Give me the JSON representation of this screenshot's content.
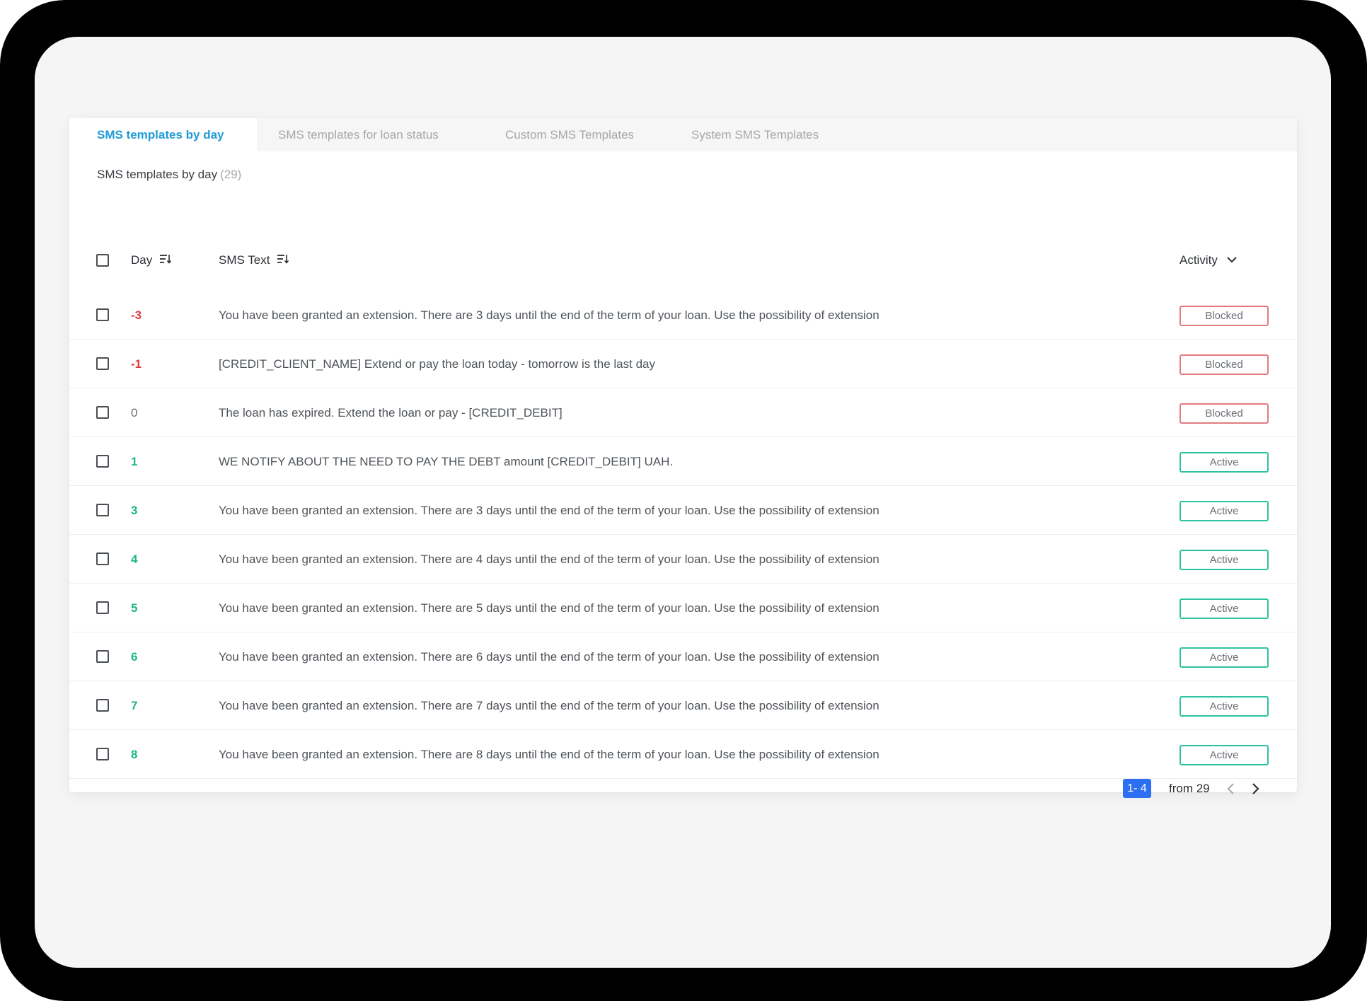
{
  "tabs": [
    {
      "label": "SMS templates by day",
      "active": true
    },
    {
      "label": "SMS templates for loan status",
      "active": false
    },
    {
      "label": "Custom SMS Templates",
      "active": false
    },
    {
      "label": "System SMS Templates",
      "active": false
    }
  ],
  "section": {
    "title": "SMS templates by day",
    "count": "(29)"
  },
  "table": {
    "columns": {
      "day": "Day",
      "sms_text": "SMS Text",
      "activity": "Activity"
    },
    "rows": [
      {
        "day": "-3",
        "text": "You have been granted an extension. There are 3 days until the end of the term of your loan. Use the possibility of extension",
        "status": "Blocked"
      },
      {
        "day": "-1",
        "text": "[CREDIT_CLIENT_NAME] Extend or pay the loan today - tomorrow is the last day",
        "status": "Blocked"
      },
      {
        "day": "0",
        "text": "The loan has expired. Extend the loan or pay - [CREDIT_DEBIT]",
        "status": "Blocked"
      },
      {
        "day": "1",
        "text": "WE NOTIFY ABOUT THE NEED TO PAY THE DEBT amount [CREDIT_DEBIT] UAH.",
        "status": "Active"
      },
      {
        "day": "3",
        "text": "You have been granted an extension. There are 3 days until the end of the term of your loan. Use the possibility of extension",
        "status": "Active"
      },
      {
        "day": "4",
        "text": "You have been granted an extension. There are 4 days until the end of the term of your loan. Use the possibility of extension",
        "status": "Active"
      },
      {
        "day": "5",
        "text": "You have been granted an extension. There are 5 days until the end of the term of your loan. Use the possibility of extension",
        "status": "Active"
      },
      {
        "day": "6",
        "text": "You have been granted an extension. There are 6 days until the end of the term of your loan. Use the possibility of extension",
        "status": "Active"
      },
      {
        "day": "7",
        "text": "You have been granted an extension. There are 7 days until the end of the term of your loan. Use the possibility of extension",
        "status": "Active"
      },
      {
        "day": "8",
        "text": "You have been granted an extension. There are 8 days until the end of the term of your loan. Use the possibility of extension",
        "status": "Active"
      }
    ]
  },
  "pagination": {
    "range": "1- 4",
    "total_label": "from 29"
  },
  "icons": {
    "sort": "sort-icon",
    "dropdown": "chevron-down-icon",
    "prev": "chevron-left-icon",
    "next": "chevron-right-icon"
  },
  "colors": {
    "tab_active": "#1e9bd7",
    "negative_day": "#e03b3b",
    "positive_day": "#1fb58a",
    "blocked_border": "#e57a7f",
    "active_border": "#2cc4a0",
    "page_badge": "#2d6ff2"
  }
}
